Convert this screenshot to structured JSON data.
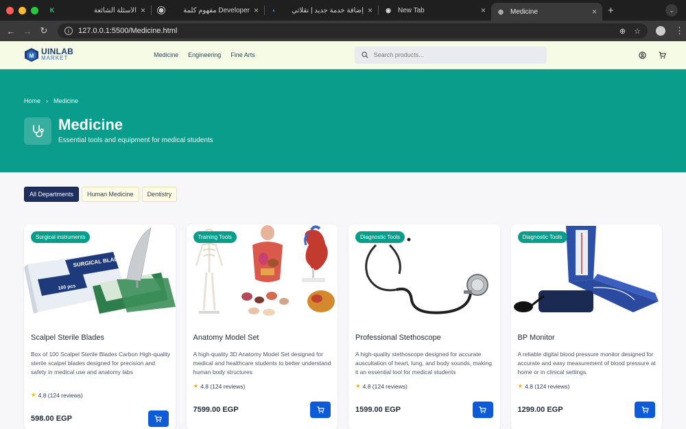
{
  "browser": {
    "tabs": [
      {
        "title": "الأسئلة الشائعة",
        "icon": "K",
        "icon_color": "#2ecc71"
      },
      {
        "title": "مفهوم كلمة Developer",
        "icon": "⊛",
        "icon_color": "#ffffff"
      },
      {
        "title": "إضافة خدمة جديد | نقلاتي",
        "icon": "◐",
        "icon_color": "#3b82f6"
      },
      {
        "title": "New Tab",
        "icon": "◉",
        "icon_color": "#dddddd"
      },
      {
        "title": "Medicine",
        "icon": "◍",
        "icon_color": "#cccccc"
      }
    ],
    "url": "127.0.0.1:5500/Medicine.html"
  },
  "header": {
    "logo_line1": "UINLAB",
    "logo_line2": "MARKET",
    "nav": [
      "Medicine",
      "Engineering",
      "Fine Arts"
    ],
    "search_placeholder": "Search products..."
  },
  "hero": {
    "breadcrumb_home": "Home",
    "breadcrumb_sep": "›",
    "breadcrumb_current": "Medicine",
    "title": "Medicine",
    "subtitle": "Essential tools and equipment for medical students"
  },
  "filters": [
    "All Departments",
    "Human Medicine",
    "Dentistry"
  ],
  "products": [
    {
      "badge": "Surgical instruments",
      "title": "Scalpel Sterile Blades",
      "description": "Box of 100 Scalpel Sterile Blades Carbon High-quality sterile scalpel blades designed for precision and safety in medical use and anatomy labs",
      "rating": "4.8 (124 reviews)",
      "price": "598.00 EGP"
    },
    {
      "badge": "Training Tools",
      "title": "Anatomy Model Set",
      "description": "A high-quality 3D Anatomy Model Set designed for medical and healthcare students to better understand human body structures",
      "rating": "4.8 (124 reviews)",
      "price": "7599.00 EGP"
    },
    {
      "badge": "Diagnostic Tools",
      "title": "Professional Stethoscope",
      "description": "A high-quality stethoscope designed for accurate auscultation of heart, lung, and body sounds, making it an essential tool for medical students",
      "rating": "4.8 (124 reviews)",
      "price": "1599.00 EGP"
    },
    {
      "badge": "Diagnostic Tools",
      "title": "BP Monitor",
      "description": "A reliable digital blood pressure monitor designed for accurate and easy measurement of blood pressure at home or in clinical settings.",
      "rating": "4.8 (124 reviews)",
      "price": "1299.00 EGP"
    }
  ],
  "colors": {
    "teal": "#0b9d8c",
    "navy": "#1e2f5e",
    "cart_blue": "#0d5bd7",
    "header_bg": "#f6fbe5"
  }
}
